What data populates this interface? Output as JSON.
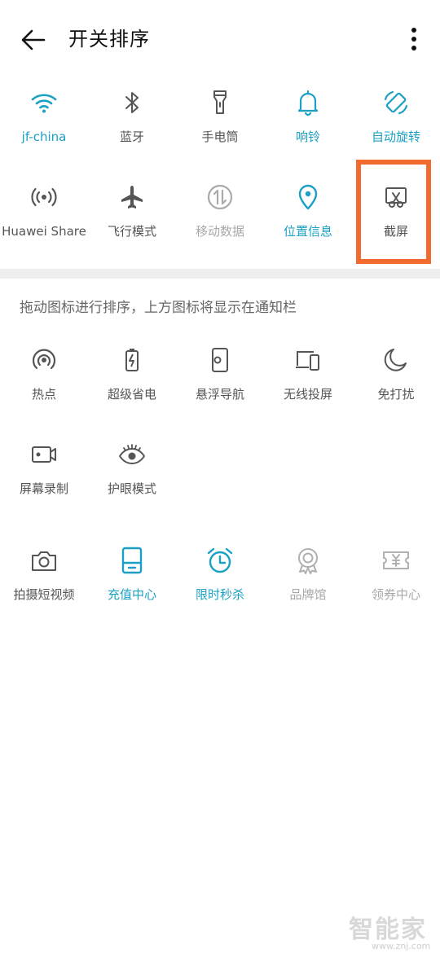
{
  "header": {
    "title": "开关排序"
  },
  "colors": {
    "active": "#1aa0c4",
    "inactive": "#555555",
    "disabled": "#a8a8a8",
    "highlight": "#f26b2e"
  },
  "active_toggles": [
    {
      "label": "jf-china",
      "icon": "wifi-icon",
      "state": "active"
    },
    {
      "label": "蓝牙",
      "icon": "bluetooth-icon",
      "state": "inactive"
    },
    {
      "label": "手电筒",
      "icon": "flashlight-icon",
      "state": "inactive"
    },
    {
      "label": "响铃",
      "icon": "bell-icon",
      "state": "active"
    },
    {
      "label": "自动旋转",
      "icon": "rotate-icon",
      "state": "active"
    },
    {
      "label": "Huawei Share",
      "icon": "share-icon",
      "state": "inactive"
    },
    {
      "label": "飞行模式",
      "icon": "airplane-icon",
      "state": "inactive"
    },
    {
      "label": "移动数据",
      "icon": "mobile-data-icon",
      "state": "disabled"
    },
    {
      "label": "位置信息",
      "icon": "location-icon",
      "state": "active"
    },
    {
      "label": "截屏",
      "icon": "screenshot-icon",
      "state": "inactive"
    }
  ],
  "hint": "拖动图标进行排序，上方图标将显示在通知栏",
  "more_toggles": [
    {
      "label": "热点",
      "icon": "hotspot-icon",
      "state": "inactive"
    },
    {
      "label": "超级省电",
      "icon": "battery-saver-icon",
      "state": "inactive"
    },
    {
      "label": "悬浮导航",
      "icon": "floating-nav-icon",
      "state": "inactive"
    },
    {
      "label": "无线投屏",
      "icon": "cast-icon",
      "state": "inactive"
    },
    {
      "label": "免打扰",
      "icon": "moon-icon",
      "state": "inactive"
    },
    {
      "label": "屏幕录制",
      "icon": "screen-record-icon",
      "state": "inactive"
    },
    {
      "label": "护眼模式",
      "icon": "eye-icon",
      "state": "inactive"
    }
  ],
  "shortcuts": [
    {
      "label": "拍摄短视频",
      "icon": "camera-icon",
      "state": "inactive"
    },
    {
      "label": "充值中心",
      "icon": "recharge-icon",
      "state": "active"
    },
    {
      "label": "限时秒杀",
      "icon": "alarm-clock-icon",
      "state": "active"
    },
    {
      "label": "品牌馆",
      "icon": "brand-badge-icon",
      "state": "disabled"
    },
    {
      "label": "领券中心",
      "icon": "coupon-icon",
      "state": "disabled"
    }
  ],
  "watermark": {
    "logo": "智能家",
    "url": "www.znj.com"
  }
}
